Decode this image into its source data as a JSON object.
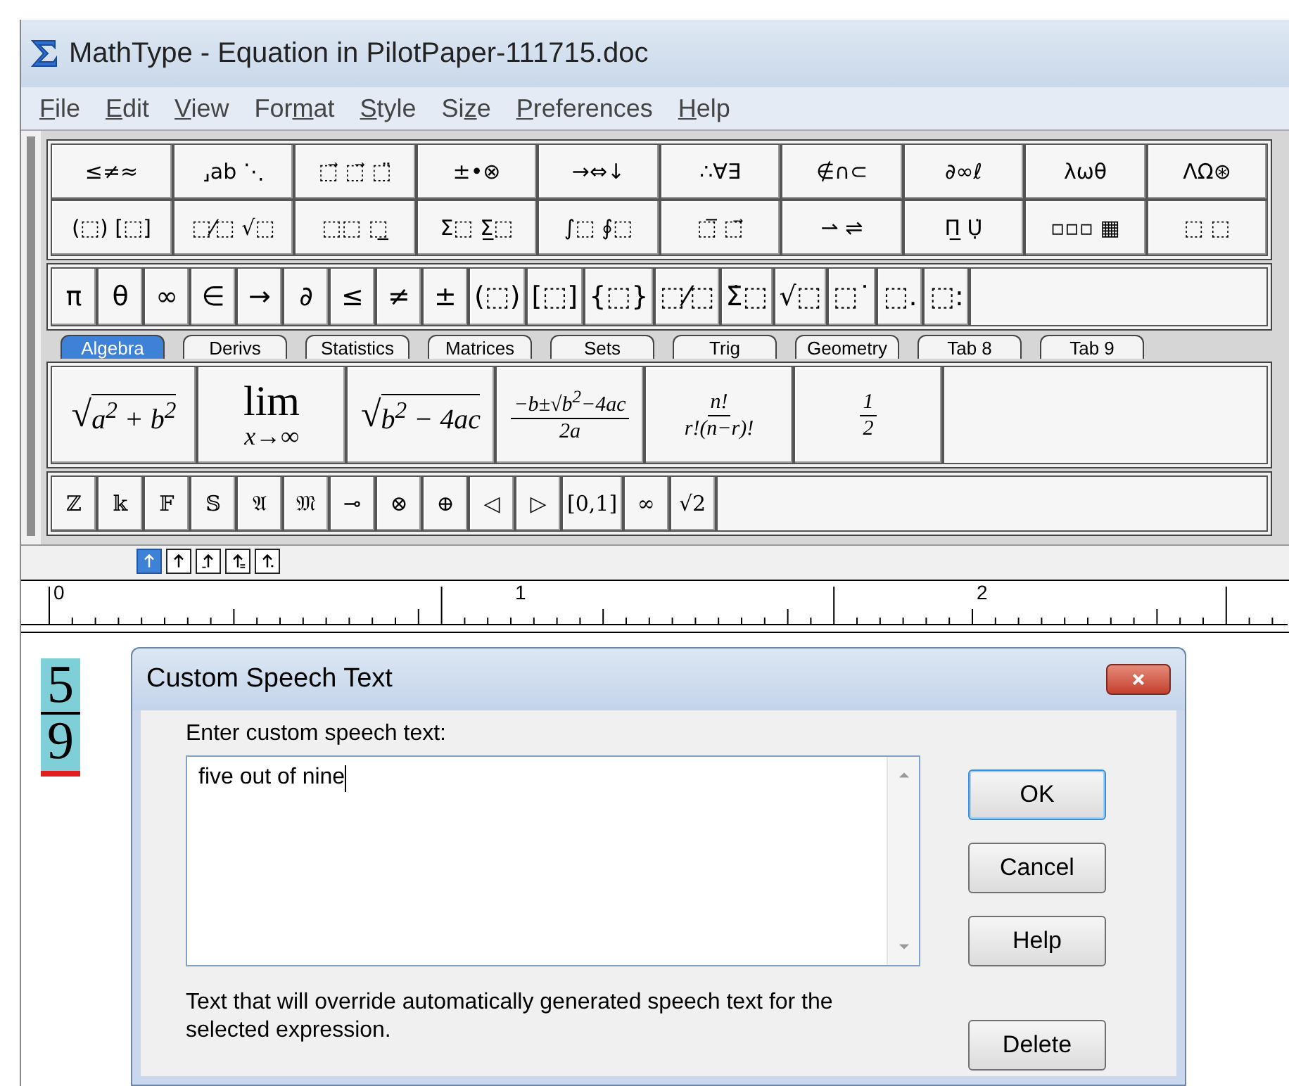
{
  "window": {
    "title": "MathType - Equation in PilotPaper-111715.doc"
  },
  "menu": [
    {
      "key": "F",
      "post": "ile"
    },
    {
      "key": "E",
      "post": "dit"
    },
    {
      "key": "V",
      "post": "iew"
    },
    {
      "pre": "For",
      "key": "m",
      "post": "at"
    },
    {
      "key": "S",
      "post": "tyle"
    },
    {
      "pre": "Si",
      "key": "z",
      "post": "e"
    },
    {
      "key": "P",
      "post": "references"
    },
    {
      "key": "H",
      "post": "elp"
    }
  ],
  "symbol_rows": [
    [
      "≤≠≈",
      "⸥ab ⋱",
      "⬚⃗ ⬚⃗ ⬚̈",
      "±•⊗",
      "→⇔↓",
      "∴∀∃",
      "∉∩⊂",
      "∂∞ℓ",
      "λωθ",
      "ΛΩ⊛"
    ],
    [
      "(⬚) [⬚]",
      "⬚⁄⬚ √⬚",
      "⬚⬚ ⬚̲",
      "Σ⬚ Σ̲⬚",
      "∫⬚ ∮⬚",
      "⬚̅ ⬚⃗",
      "⇀ ⇌",
      "Π̲ Ụ̇",
      "▫▫▫ ▦",
      "⬚ ⬚"
    ]
  ],
  "small_symbols": [
    "π",
    "θ",
    "∞",
    "∈",
    "→",
    "∂",
    "≤",
    "≠",
    "±",
    "(⬚)",
    "[⬚]",
    "{⬚}",
    "⬚⁄⬚",
    "Σ̇⬚",
    "√⬚",
    "⬚˙",
    "⬚.",
    "⬚:"
  ],
  "tabs": [
    {
      "label": "Algebra",
      "selected": true
    },
    {
      "label": "Derivs",
      "selected": false
    },
    {
      "label": "Statistics",
      "selected": false
    },
    {
      "label": "Matrices",
      "selected": false
    },
    {
      "label": "Sets",
      "selected": false
    },
    {
      "label": "Trig",
      "selected": false
    },
    {
      "label": "Geometry",
      "selected": false
    },
    {
      "label": "Tab 8",
      "selected": false
    },
    {
      "label": "Tab 9",
      "selected": false
    }
  ],
  "templates": [
    {
      "kind": "root",
      "radical": "√",
      "text": "a$^{2}$ + b$^{2}$"
    },
    {
      "kind": "limit",
      "top": "lim",
      "bottom": "x→∞"
    },
    {
      "kind": "root",
      "radical": "√",
      "text": "b$^{2}$ − 4ac"
    },
    {
      "kind": "fraction",
      "num": "−b±√b$^{2}$−4ac",
      "den": "2a"
    },
    {
      "kind": "fraction",
      "num": "n!",
      "den": "r!(n−r)!"
    },
    {
      "kind": "fraction",
      "num": "1",
      "den": "2"
    }
  ],
  "bottom_symbols": [
    "ℤ",
    "𝕜",
    "𝔽",
    "𝕊",
    "𝔄",
    "𝔐",
    "⊸",
    "⊗",
    "⊕",
    "◁",
    "▷",
    "[0,1]",
    "∞",
    "√2"
  ],
  "nudge_buttons": [
    {
      "selected": true
    },
    {
      "selected": false
    },
    {
      "selected": false
    },
    {
      "selected": false
    },
    {
      "selected": false
    }
  ],
  "ruler": {
    "labels": [
      "0",
      "1",
      "2"
    ]
  },
  "equation": {
    "numerator": "5",
    "denominator": "9"
  },
  "dialog": {
    "title": "Custom Speech Text",
    "label": "Enter custom speech text:",
    "value": "five out of nine",
    "description": "Text that will override automatically generated speech text for the selected expression.",
    "buttons": [
      {
        "label": "OK",
        "default": true
      },
      {
        "label": "Cancel",
        "default": false
      },
      {
        "label": "Help",
        "default": false
      },
      {
        "label": "Delete",
        "default": false
      }
    ]
  }
}
